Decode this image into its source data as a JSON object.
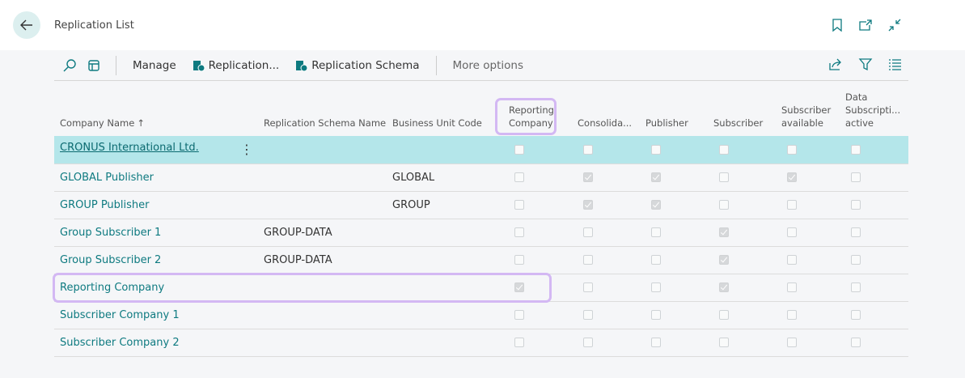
{
  "header": {
    "title": "Replication List"
  },
  "toolbar": {
    "manage": "Manage",
    "replication": "Replication...",
    "replication_schema": "Replication Schema",
    "more_options": "More options"
  },
  "columns": [
    "Company Name",
    "Replication Schema Name",
    "Business Unit Code",
    "Reporting Company",
    "Consolida...",
    "Publisher",
    "Subscriber",
    "Subscriber available",
    "Data Subscripti... active"
  ],
  "sort_indicator": "↑",
  "rows": [
    {
      "name": "CRONUS International Ltd.",
      "schema": "",
      "bu": "",
      "checks": [
        false,
        false,
        false,
        false,
        false,
        false
      ]
    },
    {
      "name": "GLOBAL Publisher",
      "schema": "",
      "bu": "GLOBAL",
      "checks": [
        false,
        true,
        true,
        false,
        true,
        false
      ]
    },
    {
      "name": "GROUP Publisher",
      "schema": "",
      "bu": "GROUP",
      "checks": [
        false,
        true,
        true,
        false,
        false,
        false
      ]
    },
    {
      "name": "Group Subscriber 1",
      "schema": "GROUP-DATA",
      "bu": "",
      "checks": [
        false,
        false,
        false,
        true,
        false,
        false
      ]
    },
    {
      "name": "Group Subscriber 2",
      "schema": "GROUP-DATA",
      "bu": "",
      "checks": [
        false,
        false,
        false,
        true,
        false,
        false
      ]
    },
    {
      "name": "Reporting Company",
      "schema": "",
      "bu": "",
      "checks": [
        true,
        false,
        false,
        true,
        false,
        false
      ]
    },
    {
      "name": "Subscriber Company 1",
      "schema": "",
      "bu": "",
      "checks": [
        false,
        false,
        false,
        false,
        false,
        false
      ]
    },
    {
      "name": "Subscriber Company 2",
      "schema": "",
      "bu": "",
      "checks": [
        false,
        false,
        false,
        false,
        false,
        false
      ]
    }
  ],
  "colors": {
    "accent": "#0e7a80",
    "selected_row": "#b4e6ea",
    "highlight": "#d3b8f3"
  }
}
